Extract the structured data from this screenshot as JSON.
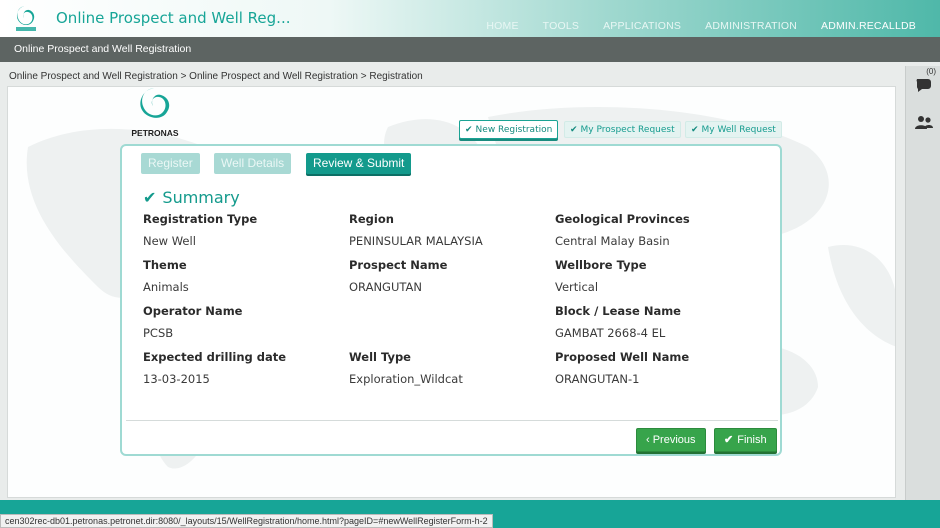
{
  "header": {
    "app_title": "Online Prospect and Well Reg...",
    "nav": [
      "HOME",
      "TOOLS",
      "APPLICATIONS",
      "ADMINISTRATION"
    ],
    "user": "ADMIN.RECALLDB",
    "brand_text": "PETRONAS"
  },
  "subbar": {
    "title": "Online Prospect and Well Registration"
  },
  "breadcrumb": "Online Prospect and Well Registration > Online Prospect and Well Registration > Registration",
  "rail": {
    "notification_count": "(0)"
  },
  "brand": {
    "logo_text": "PETRONAS"
  },
  "tabs": [
    {
      "label": "New Registration",
      "active": true
    },
    {
      "label": "My Prospect Request",
      "active": false
    },
    {
      "label": "My Well Request",
      "active": false
    }
  ],
  "steps": [
    {
      "label": "Register",
      "state": "disabled"
    },
    {
      "label": "Well Details",
      "state": "disabled"
    },
    {
      "label": "Review & Submit",
      "state": "current"
    }
  ],
  "summary": {
    "title": "Summary",
    "fields": {
      "registration_type": {
        "label": "Registration Type",
        "value": "New Well"
      },
      "region": {
        "label": "Region",
        "value": "PENINSULAR MALAYSIA"
      },
      "geological_provinces": {
        "label": "Geological Provinces",
        "value": "Central Malay Basin"
      },
      "theme": {
        "label": "Theme",
        "value": "Animals"
      },
      "prospect_name": {
        "label": "Prospect Name",
        "value": "ORANGUTAN"
      },
      "wellbore_type": {
        "label": "Wellbore Type",
        "value": "Vertical"
      },
      "operator_name": {
        "label": "Operator Name",
        "value": "PCSB"
      },
      "block_lease_name": {
        "label": "Block / Lease Name",
        "value": "GAMBAT 2668-4 EL"
      },
      "expected_drilling_date": {
        "label": "Expected drilling date",
        "value": "13-03-2015"
      },
      "well_type": {
        "label": "Well Type",
        "value": "Exploration_Wildcat"
      },
      "proposed_well_name": {
        "label": "Proposed Well Name",
        "value": "ORANGUTAN-1"
      }
    }
  },
  "buttons": {
    "previous": "‹ Previous",
    "finish": "Finish"
  },
  "statusbar": {
    "url": "cen302rec-db01.petronas.petronet.dir:8080/_layouts/15/WellRegistration/home.html?pageID=#newWellRegisterForm-h-2"
  },
  "colors": {
    "brand": "#17a597",
    "button_green": "#37a44b",
    "subbar": "#5d6462"
  }
}
